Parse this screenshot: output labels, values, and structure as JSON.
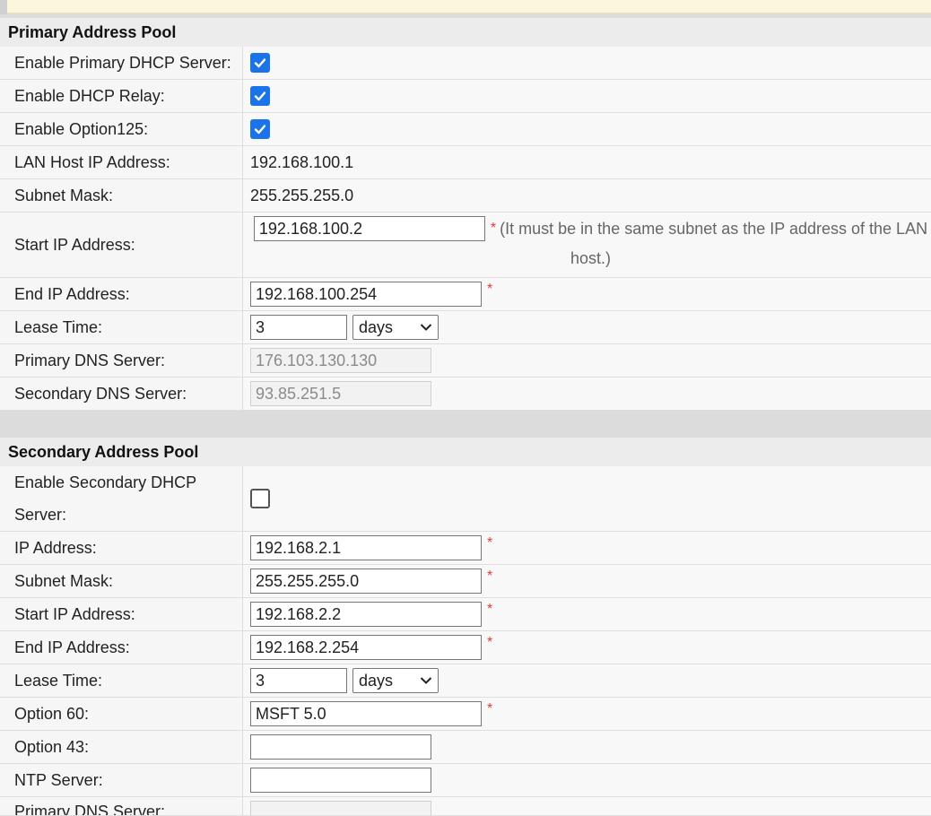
{
  "primary": {
    "title": "Primary Address Pool",
    "enable_primary_label": "Enable Primary DHCP Server:",
    "enable_relay_label": "Enable DHCP Relay:",
    "enable_opt125_label": "Enable Option125:",
    "lan_host_label": "LAN Host IP Address:",
    "lan_host_value": "192.168.100.1",
    "subnet_label": "Subnet Mask:",
    "subnet_value": "255.255.255.0",
    "start_label": "Start IP Address:",
    "start_value": "192.168.100.2",
    "start_hint_1": "(It must be in the same subnet as the IP address of the LAN",
    "start_hint_2": "host.)",
    "end_label": "End IP Address:",
    "end_value": "192.168.100.254",
    "lease_label": "Lease Time:",
    "lease_value": "3",
    "lease_unit": "days",
    "dns1_label": "Primary DNS Server:",
    "dns1_value": "176.103.130.130",
    "dns2_label": "Secondary DNS Server:",
    "dns2_value": "93.85.251.5"
  },
  "secondary": {
    "title": "Secondary Address Pool",
    "enable_label_1": "Enable Secondary DHCP",
    "enable_label_2": "Server:",
    "ip_label": "IP Address:",
    "ip_value": "192.168.2.1",
    "subnet_label": "Subnet Mask:",
    "subnet_value": "255.255.255.0",
    "start_label": "Start IP Address:",
    "start_value": "192.168.2.2",
    "end_label": "End IP Address:",
    "end_value": "192.168.2.254",
    "lease_label": "Lease Time:",
    "lease_value": "3",
    "lease_unit": "days",
    "opt60_label": "Option 60:",
    "opt60_value": "MSFT 5.0",
    "opt43_label": "Option 43:",
    "opt43_value": "",
    "ntp_label": "NTP Server:",
    "ntp_value": "",
    "dns1_label": "Primary DNS Server:"
  },
  "common": {
    "required_mark": "*"
  },
  "colors": {
    "checkbox_accent": "#1a73e8",
    "required": "#e53935"
  },
  "icons": {
    "check": "check-icon",
    "dropdown": "chevron-down-icon"
  }
}
